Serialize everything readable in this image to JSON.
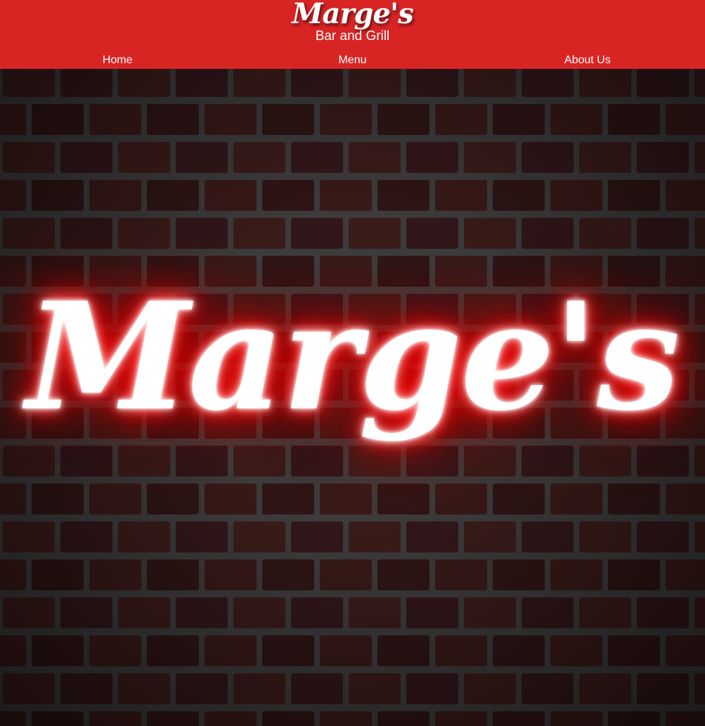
{
  "header": {
    "title": "Marge's",
    "subtitle": "Bar and Grill",
    "background_color": "#d92424"
  },
  "nav": {
    "items": [
      {
        "label": "Home"
      },
      {
        "label": "Menu"
      },
      {
        "label": "About Us"
      }
    ]
  },
  "hero": {
    "sign_text": "Marge's",
    "background": "brick-wall",
    "glow_color": "#ff0000"
  }
}
